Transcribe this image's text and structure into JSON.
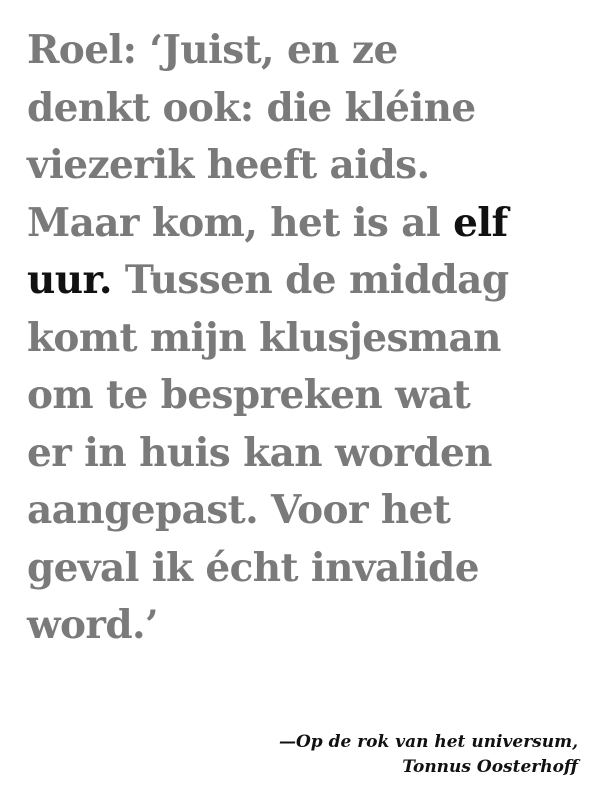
{
  "quote": {
    "lines": [
      "Roel: ‘Juist, en ze",
      "denkt ook: die kléine",
      "viezerik heeft aids.",
      "Maar kom, het is al ",
      "elf",
      "uur.",
      " Tussen de middag",
      "komt mijn klusjesman",
      "om te bespreken wat",
      "er in huis kan worden",
      "aangepast. Voor het",
      "geval ik écht invalide",
      "word.’"
    ]
  },
  "attribution": {
    "line1": "—Op de rok van het universum,",
    "line2": "Tonnus Oosterhoff"
  },
  "colors": {
    "text_gray": "#7a7a7a",
    "text_emphasis": "#111111",
    "background": "#ffffff"
  }
}
